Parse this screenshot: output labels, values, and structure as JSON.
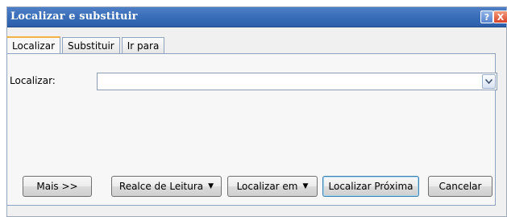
{
  "window": {
    "title": "Localizar e substituir",
    "help_glyph": "?",
    "close_glyph": "X"
  },
  "tabs": [
    {
      "label": "Localizar",
      "active": true
    },
    {
      "label": "Substituir",
      "active": false
    },
    {
      "label": "Ir para",
      "active": false
    }
  ],
  "find": {
    "label": "Localizar:",
    "value": "",
    "placeholder": ""
  },
  "buttons": {
    "more": "Mais >>",
    "reading_highlight": "Realce de Leitura",
    "find_in": "Localizar em",
    "find_next": "Localizar Próxima",
    "cancel": "Cancelar"
  },
  "colors": {
    "titlebar": "#3b6fba",
    "active_tab_accent": "#f2b345",
    "default_button_border": "#3c7fb1"
  },
  "icons": {
    "dropdown": "chevron-down-icon",
    "help": "help-icon",
    "close": "close-icon"
  }
}
